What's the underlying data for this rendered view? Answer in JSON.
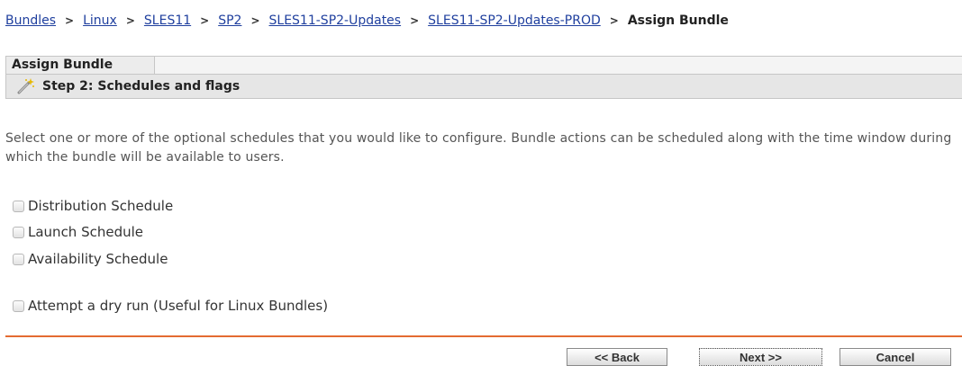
{
  "breadcrumb": {
    "items": [
      {
        "label": "Bundles"
      },
      {
        "label": "Linux"
      },
      {
        "label": "SLES11"
      },
      {
        "label": "SP2"
      },
      {
        "label": "SLES11-SP2-Updates"
      },
      {
        "label": "SLES11-SP2-Updates-PROD"
      }
    ],
    "separator": ">",
    "current": "Assign Bundle"
  },
  "panel": {
    "tab_label": "Assign Bundle",
    "step_title": "Step 2: Schedules and flags",
    "step_icon": "wizard-wand-icon"
  },
  "description": "Select one or more of the optional schedules that you would like to configure. Bundle actions can be scheduled along with the time window during which the bundle will be available to users.",
  "options": {
    "distribution": "Distribution Schedule",
    "launch": "Launch Schedule",
    "availability": "Availability Schedule",
    "dry_run": "Attempt a dry run (Useful for Linux Bundles)"
  },
  "buttons": {
    "back": "<< Back",
    "next": "Next >>",
    "cancel": "Cancel"
  },
  "colors": {
    "link": "#1f3f9e",
    "divider": "#e46b32"
  }
}
